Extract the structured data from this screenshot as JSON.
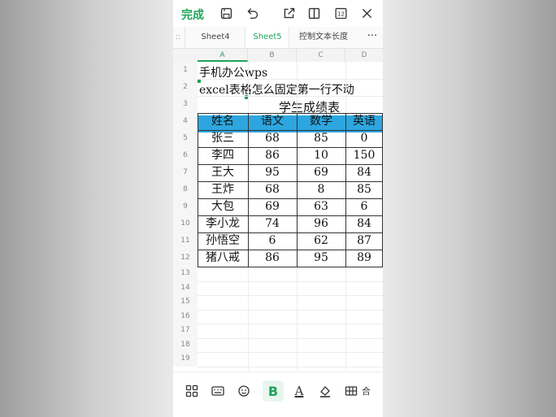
{
  "topbar": {
    "done_label": "完成",
    "icons": [
      "save-icon",
      "undo-icon",
      "share-icon",
      "reading-mode-icon",
      "sheet-count-icon",
      "close-icon"
    ],
    "sheet_count": "12"
  },
  "tabs": {
    "items": [
      {
        "label": "Sheet4",
        "active": false
      },
      {
        "label": "Sheet5",
        "active": true
      },
      {
        "label": "控制文本长度",
        "active": false
      }
    ],
    "more": "···",
    "partial": "::"
  },
  "columns": [
    "A",
    "B",
    "C",
    "D"
  ],
  "rows": [
    "1",
    "2",
    "3",
    "4",
    "5",
    "6",
    "7",
    "8",
    "9",
    "10",
    "11",
    "12",
    "13",
    "14",
    "15",
    "16",
    "17",
    "18",
    "19"
  ],
  "cells": {
    "a1": "手机办公wps",
    "a2": "excel表格怎么固定第一行不动",
    "title": "学生成绩表"
  },
  "table": {
    "headers": [
      "姓名",
      "语文",
      "数学",
      "英语"
    ],
    "rows": [
      [
        "张三",
        "68",
        "85",
        "0"
      ],
      [
        "李四",
        "86",
        "10",
        "150"
      ],
      [
        "王大",
        "95",
        "69",
        "84"
      ],
      [
        "王炸",
        "68",
        "8",
        "85"
      ],
      [
        "大包",
        "69",
        "63",
        "6"
      ],
      [
        "李小龙",
        "74",
        "96",
        "84"
      ],
      [
        "孙悟空",
        "6",
        "62",
        "87"
      ],
      [
        "猪八戒",
        "86",
        "95",
        "89"
      ]
    ],
    "header_color": "#2da6df"
  },
  "bottombar": {
    "bold_label": "B",
    "font_color_label": "A",
    "merge_label": "合"
  },
  "colors": {
    "accent": "#1fa35c"
  }
}
